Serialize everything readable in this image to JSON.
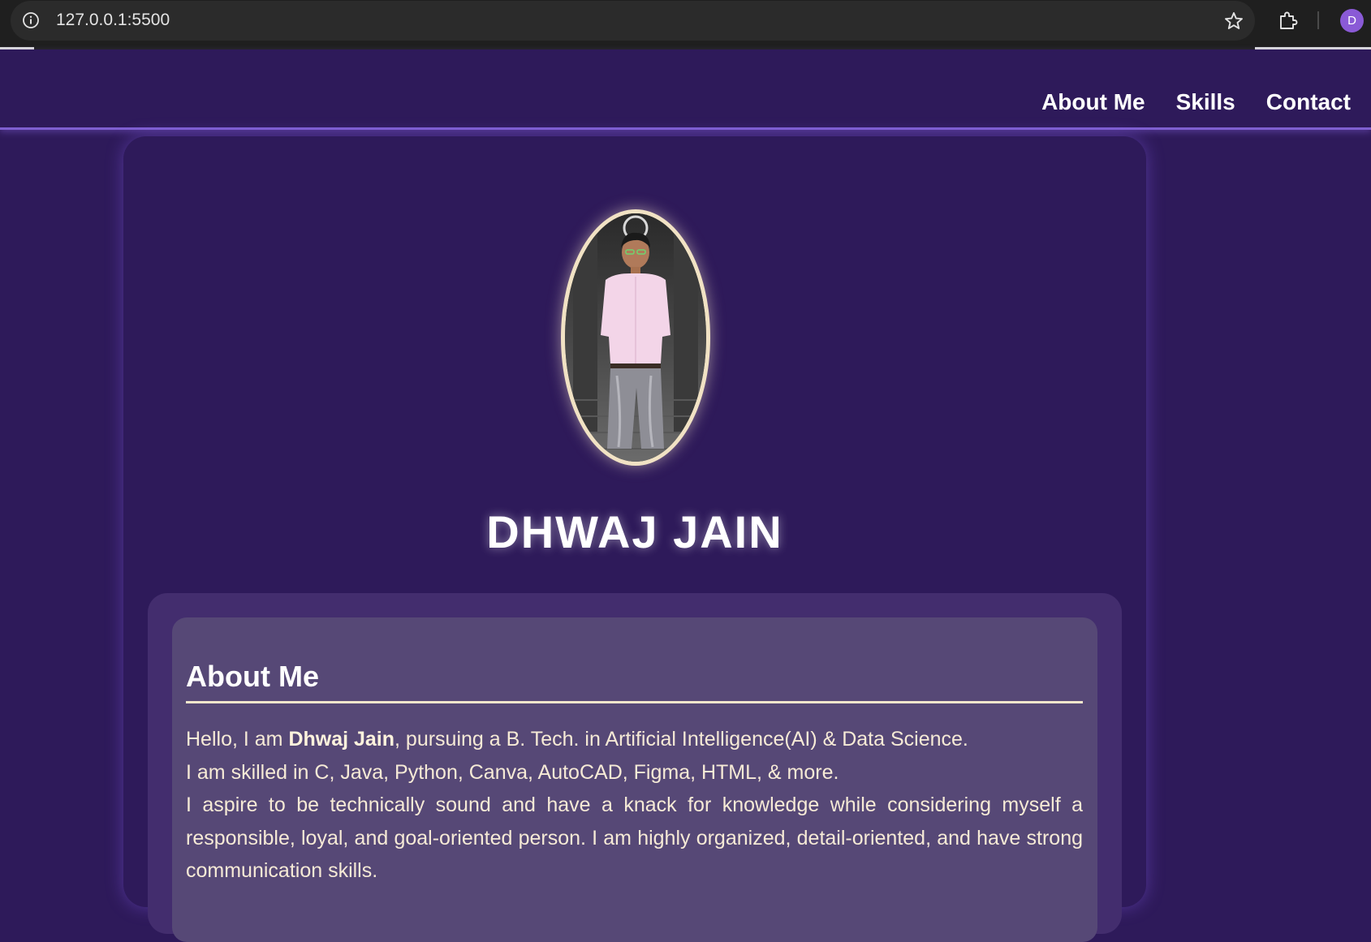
{
  "browser": {
    "url": "127.0.0.1:5500",
    "profile_initial": "D"
  },
  "nav": {
    "items": [
      "About Me",
      "Skills",
      "Contact"
    ]
  },
  "profile": {
    "name": "DHWAJ JAIN"
  },
  "about": {
    "heading": "About Me",
    "intro_prefix": "Hello, I am ",
    "intro_name": "Dhwaj Jain",
    "intro_suffix": ", pursuing a B. Tech. in Artificial Intelligence(AI) & Data Science.",
    "skills_line": "I am skilled in C, Java, Python, Canva, AutoCAD, Figma, HTML, & more.",
    "aspiration": "I aspire to be technically sound and have a knack for knowledge while considering myself a responsible, loyal, and goal-oriented person. I am highly organized, detail-oriented, and have strong communication skills."
  },
  "colors": {
    "page_bg": "#2e1a5a",
    "accent": "#7f5fd0",
    "cream": "#f1e2c4"
  }
}
